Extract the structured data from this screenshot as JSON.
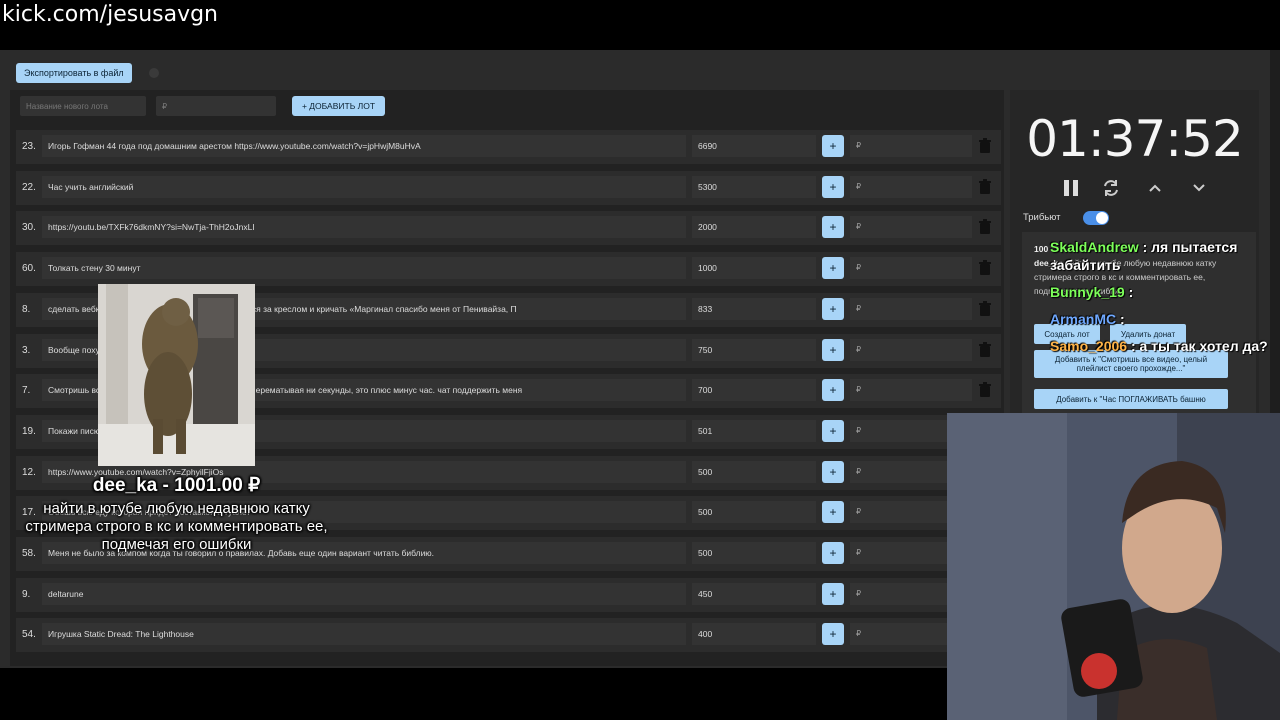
{
  "browser": {
    "url": "kick.com/jesusavgn"
  },
  "toolbar": {
    "export_label": "Экспортировать в файл"
  },
  "new_lot": {
    "name_placeholder": "Название нового лота",
    "amount_placeholder": "₽",
    "add_label": "+ ДОБАВИТЬ ЛОТ"
  },
  "lots": [
    {
      "num": "23.",
      "title": "Игорь Гофман 44 года под домашним арестом https://www.youtube.com/watch?v=jpHwjM8uHvA",
      "amount": "6690"
    },
    {
      "num": "22.",
      "title": "Час учить английский",
      "amount": "5300"
    },
    {
      "num": "30.",
      "title": "https://youtu.be/TXFk76dkmNY?si=NwTja-ThH2oJnxLI",
      "amount": "2000"
    },
    {
      "num": "60.",
      "title": "Толкать стену 30 минут",
      "amount": "1000"
    },
    {
      "num": "8.",
      "title": "сделать вебк… отку Пенивайза. и 60 минут прятаться за креслом и кричать «Маргинал спасибо меня от Пенивайза, П",
      "amount": "833"
    },
    {
      "num": "3.",
      "title": "Вообще похуй",
      "amount": "750"
    },
    {
      "num": "7.",
      "title": "Смотришь вс… ождение the curse of blackwater, не перематывая ни секунды, это плюс минус час. чат поддержить меня",
      "amount": "700"
    },
    {
      "num": "19.",
      "title": "Покажи писю… е",
      "amount": "501"
    },
    {
      "num": "12.",
      "title": "https://www.youtube.com/watch?v=ZphyilFjiOs",
      "amount": "500"
    },
    {
      "num": "17.",
      "title": "Съешь всю еду которая придёт доставкой в туалет",
      "amount": "500"
    },
    {
      "num": "58.",
      "title": "Меня не было за компом когда ты говорил о правилах. Добавь еще один вариант читать библию.",
      "amount": "500"
    },
    {
      "num": "9.",
      "title": "deltarune",
      "amount": "450"
    },
    {
      "num": "54.",
      "title": "Игрушка Static Dread: The Lighthouse",
      "amount": "400"
    }
  ],
  "row_labels": {
    "plus": "+",
    "donate_placeholder": "₽"
  },
  "timer": {
    "value": "01:37:52"
  },
  "side": {
    "tribute_label": "Трибьют",
    "tribute_enabled": true,
    "donation_amount": "100",
    "donation_user": "dee_ka",
    "donation_text": "найти в ютубе любую недавнюю катку стримера строго в кс и комментировать ее, подмечая его ошибки",
    "create_lot": "Создать лот",
    "delete_donation": "Удалить донат",
    "add_to_1": "Добавить к \"Смотришь все видео, целый плейлист своего прохожде...\"",
    "add_to_2": "Добавить к \"Час ПОГЛАЖИВАТЬ башню"
  },
  "overlay": {
    "donor": "dee_ka - 1001.00 ₽",
    "message": "найти в ютубе любую недавнюю катку стримера строго в кс и комментировать ее, подмечая его ошибки"
  },
  "chat": [
    {
      "user": "SkaldAndrew",
      "color": "#7dff5a",
      "text": ": ля пытается забайтить"
    },
    {
      "user": "Bunnyk_19",
      "color": "#7dff5a",
      "text": ":"
    },
    {
      "user": "ArmanMC",
      "color": "#6fa8ff",
      "text": ":"
    },
    {
      "user": "Samo_2006",
      "color": "#ffb347",
      "text": ": а ты так хотел да?"
    }
  ]
}
